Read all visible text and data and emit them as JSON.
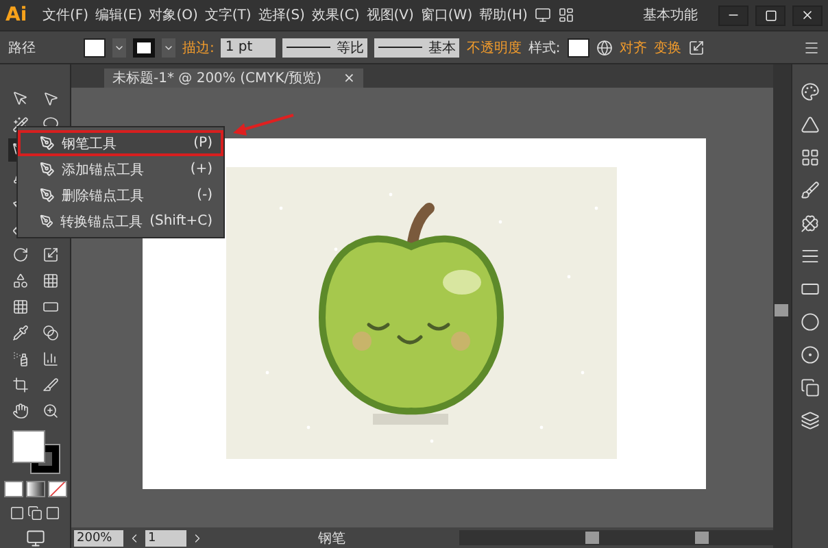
{
  "app": {
    "logo": "Ai",
    "workspace": "基本功能"
  },
  "menu": [
    "文件(F)",
    "编辑(E)",
    "对象(O)",
    "文字(T)",
    "选择(S)",
    "效果(C)",
    "视图(V)",
    "窗口(W)",
    "帮助(H)"
  ],
  "control_bar": {
    "object": "路径",
    "stroke_label": "描边:",
    "stroke_value": "1 pt",
    "profile": "等比",
    "brush": "基本",
    "opacity": "不透明度",
    "style_label": "样式:",
    "align": "对齐",
    "transform": "变换"
  },
  "document_tab": {
    "title": "未标题-1* @ 200% (CMYK/预览)",
    "close": "×"
  },
  "flyout": [
    {
      "label": "钢笔工具",
      "shortcut": "(P)",
      "selected": true
    },
    {
      "label": "添加锚点工具",
      "shortcut": "(+)",
      "selected": false
    },
    {
      "label": "删除锚点工具",
      "shortcut": "(-)",
      "selected": false
    },
    {
      "label": "转换锚点工具",
      "shortcut": "(Shift+C)",
      "selected": false
    }
  ],
  "status_bar": {
    "zoom": "200%",
    "page": "1",
    "tool": "钢笔"
  }
}
